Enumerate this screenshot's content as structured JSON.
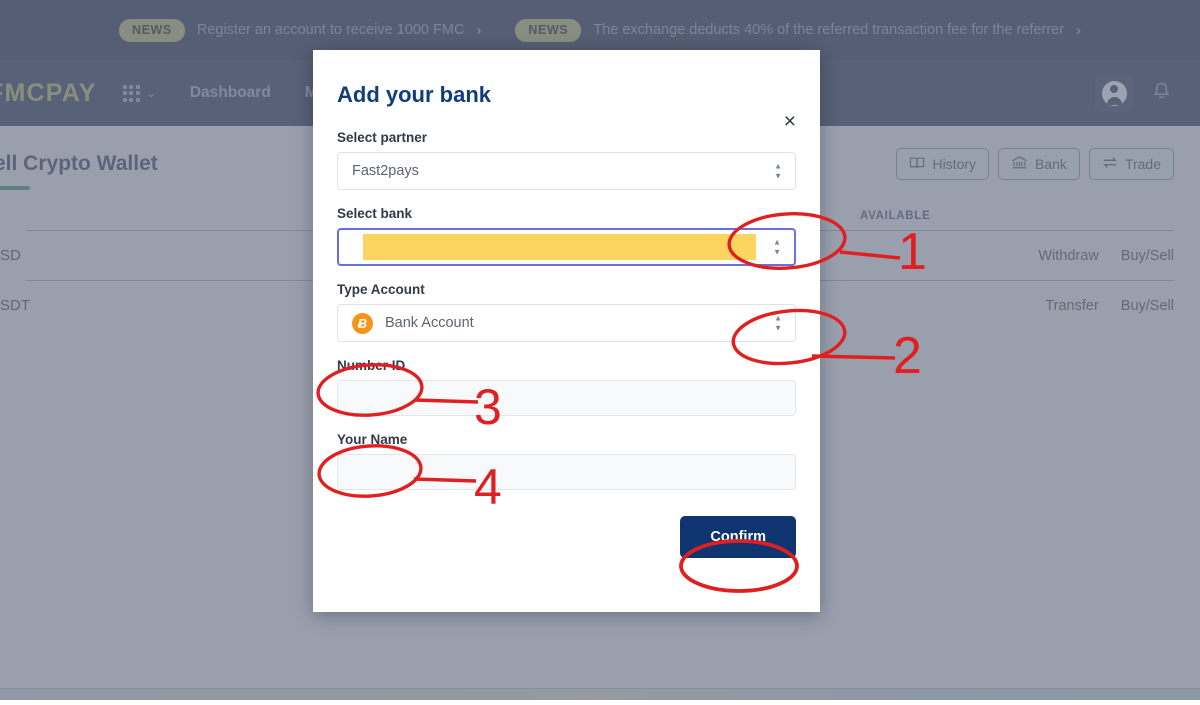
{
  "news": [
    {
      "pill": "NEWS",
      "text": "Register an account to receive 1000 FMC",
      "arrow": "›"
    },
    {
      "pill": "NEWS",
      "text": "The exchange deducts 40% of the referred transaction fee for the referrer",
      "arrow": "›"
    }
  ],
  "nav": {
    "brand": "FMCPAY",
    "grid_caret": "⌄",
    "links": [
      {
        "label": "Dashboard"
      },
      {
        "label": "Ma"
      }
    ],
    "account_icon": "user-icon",
    "bell_icon": "bell-icon"
  },
  "page": {
    "title": "ell Crypto Wallet",
    "toolbar": [
      {
        "label": "History",
        "icon": "book-icon"
      },
      {
        "label": "Bank",
        "icon": "bank-icon"
      },
      {
        "label": "Trade",
        "icon": "exchange-arrows-icon"
      }
    ],
    "table": {
      "headers": {
        "coin": "",
        "available": "AVAILABLE"
      },
      "rows": [
        {
          "coin": "SD",
          "actions": [
            "Withdraw",
            "Buy/Sell"
          ]
        },
        {
          "coin": "SDT",
          "actions": [
            "Transfer",
            "Buy/Sell"
          ]
        }
      ]
    }
  },
  "modal": {
    "title": "Add your bank",
    "close_label": "×",
    "fields": {
      "partner": {
        "label": "Select partner",
        "value": "Fast2pays",
        "spinner_up": "▲",
        "spinner_down": "▼"
      },
      "bank": {
        "label": "Select bank",
        "value": "",
        "redacted": true,
        "spinner_up": "▲",
        "spinner_down": "▼"
      },
      "type_account": {
        "label": "Type Account",
        "value": "Bank Account",
        "icon": "bitcoin-icon",
        "icon_glyph": "Ƀ",
        "spinner_up": "▲",
        "spinner_down": "▼"
      },
      "number_id": {
        "label": "Number ID",
        "value": "",
        "placeholder": ""
      },
      "your_name": {
        "label": "Your Name",
        "value": "",
        "placeholder": ""
      }
    },
    "confirm_label": "Confirm"
  },
  "annotations": {
    "color": "#e02020",
    "markers": [
      {
        "number": "1",
        "target": "select-bank-spinner"
      },
      {
        "number": "2",
        "target": "type-account-spinner"
      },
      {
        "number": "3",
        "target": "number-id-label"
      },
      {
        "number": "4",
        "target": "your-name-label"
      },
      {
        "number": "",
        "target": "confirm-button-circle"
      }
    ]
  },
  "colors": {
    "brand": "#c9ca85",
    "header_bg": "#525a70",
    "newsbar_bg": "#4c5469",
    "modal_title": "#123d7d",
    "confirm_bg": "#0f3570",
    "redaction": "#fcd560",
    "focus_border": "#6a6fe0",
    "annotation_red": "#e02020",
    "title_underline": "#5aab8a",
    "bitcoin_orange": "#f7931a"
  }
}
